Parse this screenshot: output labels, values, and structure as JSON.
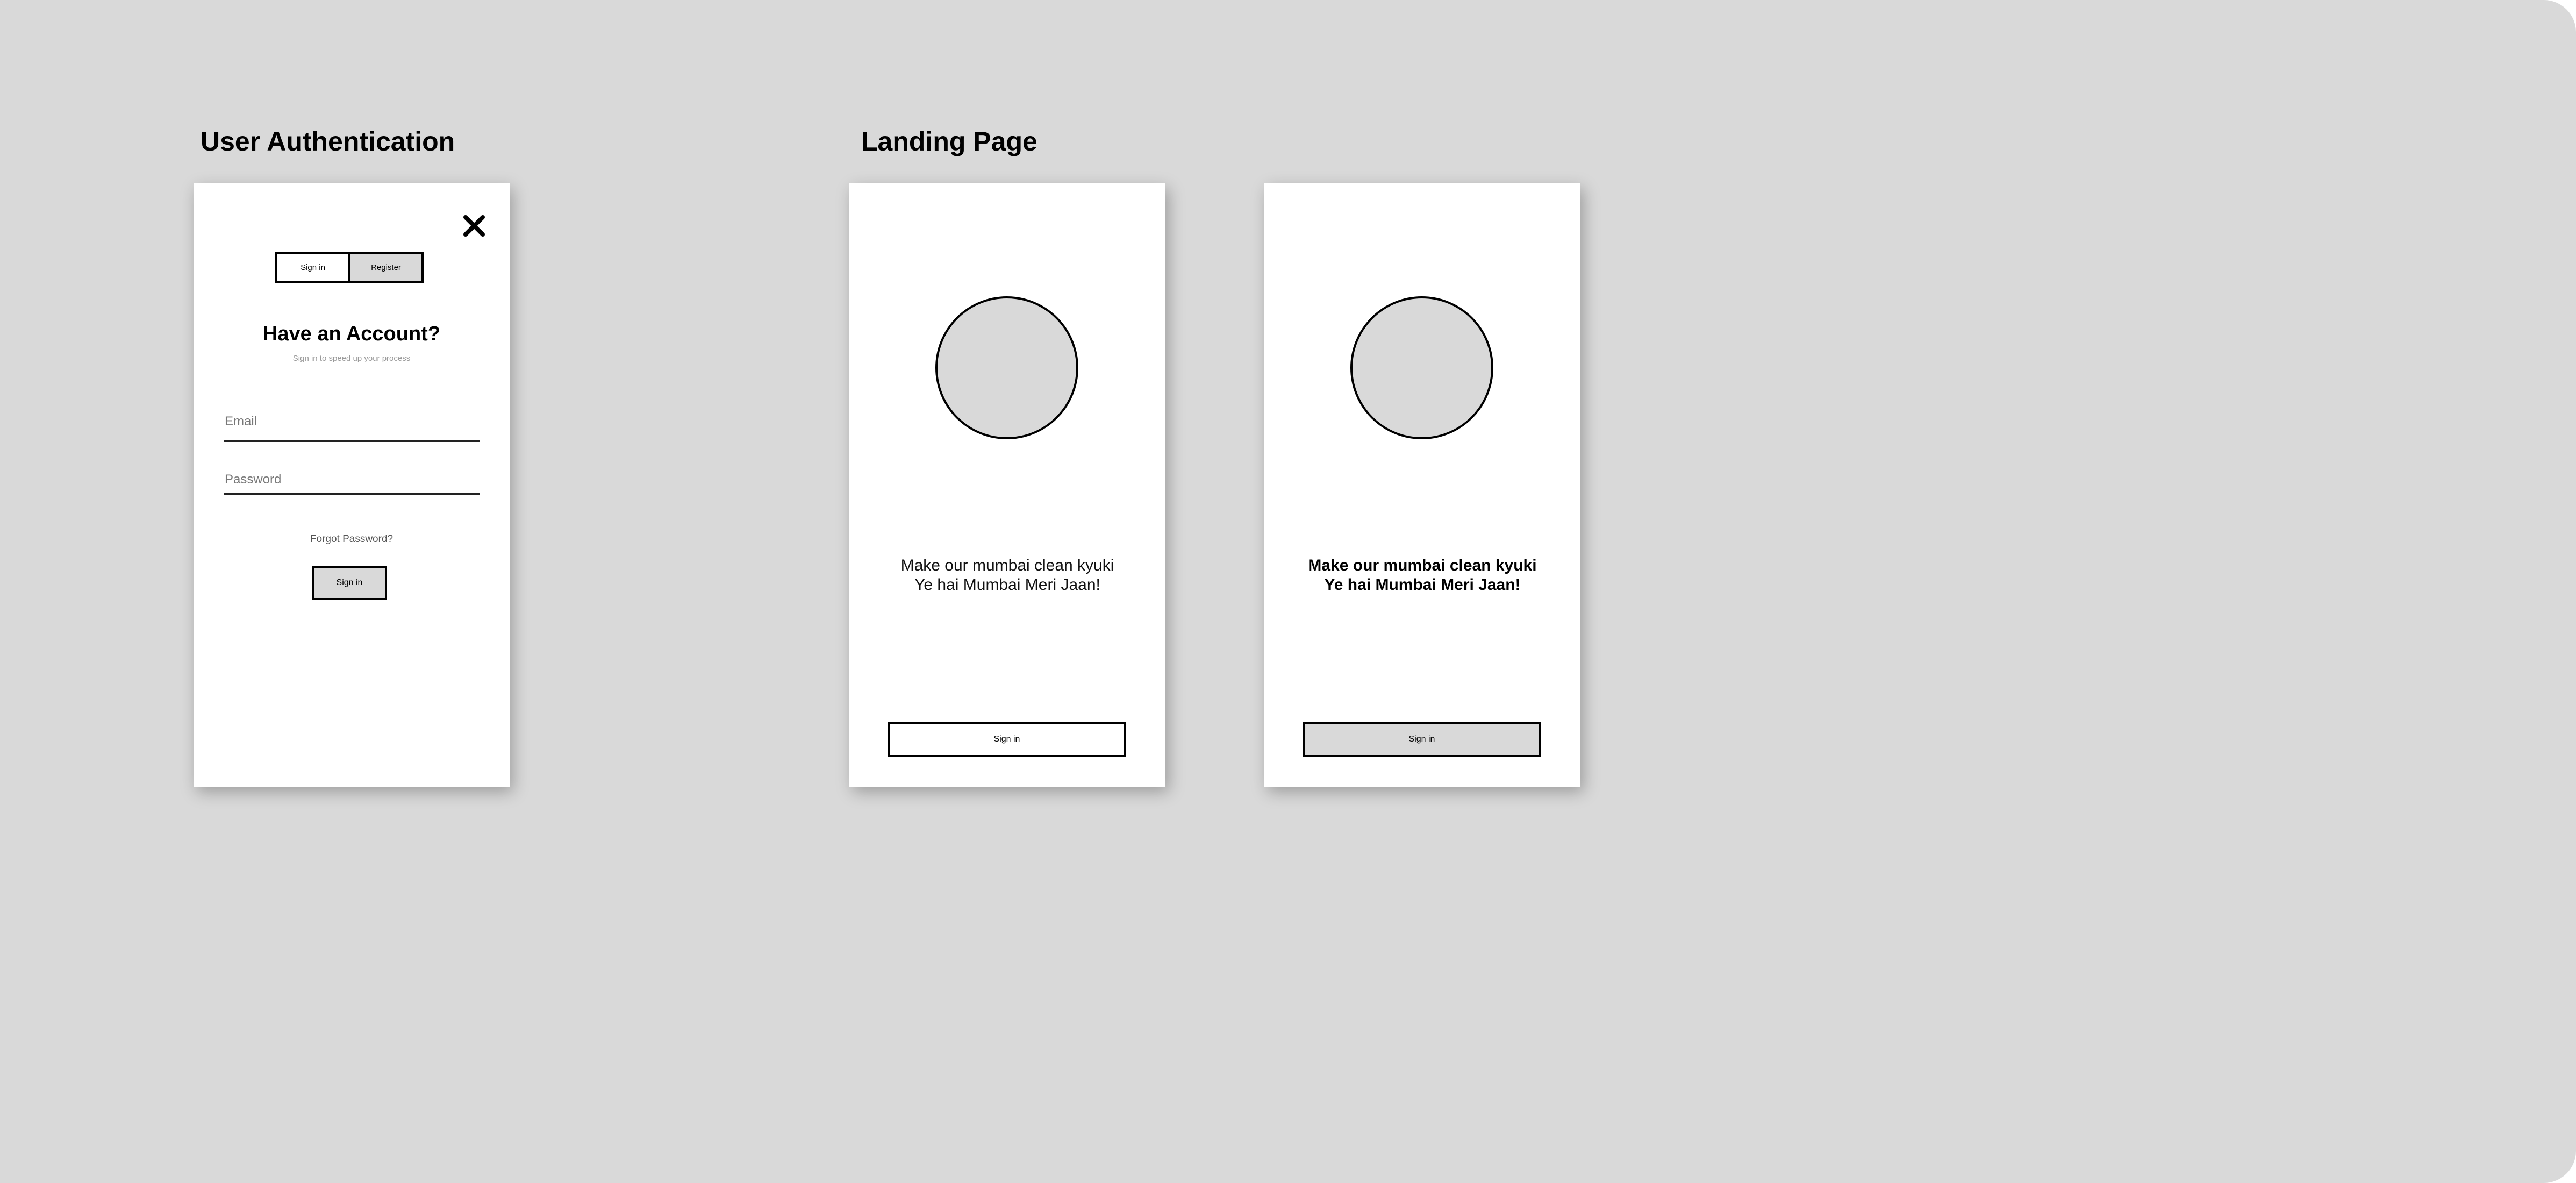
{
  "sections": {
    "auth_title": "User Authentication",
    "landing_title": "Landing Page"
  },
  "auth": {
    "close_icon": "close-icon",
    "toggle": {
      "signin_label": "Sign in",
      "register_label": "Register",
      "selected": "Register"
    },
    "heading": "Have an Account?",
    "subheading": "Sign in to speed up your process",
    "email_placeholder": "Email",
    "email_value": "",
    "password_placeholder": "Password",
    "password_value": "",
    "forgot_label": "Forgot Password?",
    "signin_label": "Sign in"
  },
  "landing1": {
    "tagline_line1": "Make our mumbai clean kyuki",
    "tagline_line2": "Ye hai Mumbai Meri Jaan!",
    "signin_label": "Sign in"
  },
  "landing2": {
    "tagline_line1": "Make our mumbai clean kyuki",
    "tagline_line2": "Ye hai Mumbai Meri Jaan!",
    "signin_label": "Sign in"
  },
  "colors": {
    "canvas": "#d9d9d9",
    "frame": "#ffffff",
    "accent": "#000000"
  }
}
